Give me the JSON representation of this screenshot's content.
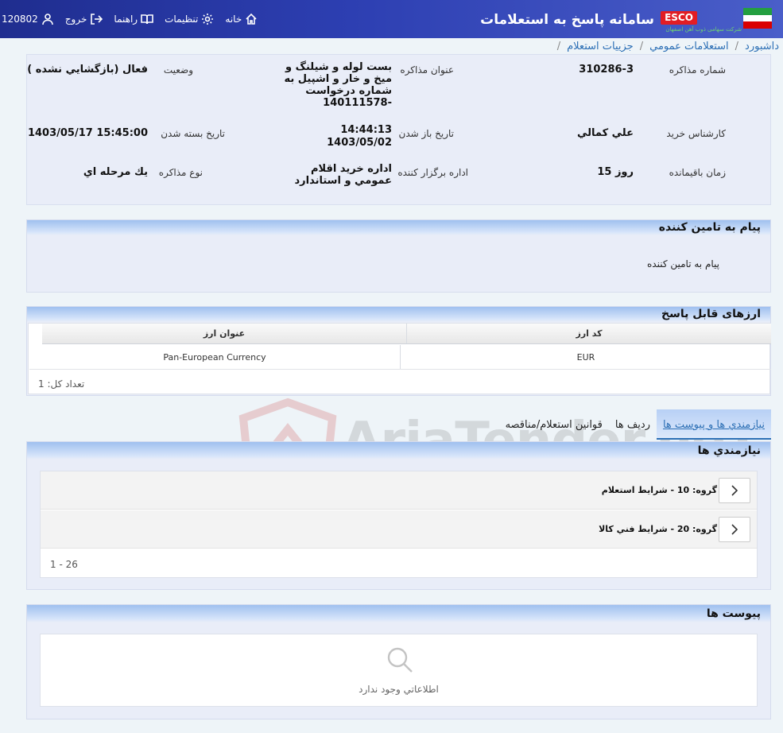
{
  "header": {
    "title": "سامانه پاسخ به استعلامات",
    "logo_text": "ESCO",
    "logo_subtitle": "شرکت سهامی ذوب آهن اصفهان",
    "nav": {
      "home": "خانه",
      "settings": "تنظیمات",
      "help": "راهنما",
      "logout": "خروج",
      "user_id": "120802"
    }
  },
  "breadcrumb": {
    "items": [
      "ه داشبورد",
      "استعلامات عمومي",
      "جزييات استعلام"
    ],
    "separator": "/"
  },
  "inquiry": {
    "number_label": "شماره مذاکره",
    "number_value": "310286-3",
    "subject_label": "عنوان مذاکره",
    "subject_value": "بست لوله و شيلنگ و ميخ و خار و اشپيل به شماره درخواست 140111578-",
    "status_label": "وضعيت",
    "status_value": "فعال (بازگشايي نشده )",
    "buyer_label": "کارشناس خريد",
    "buyer_value": "علي کمالي",
    "open_date_label": "تاريخ باز شدن",
    "open_time_value": "14:44:13",
    "open_date_value": "1403/05/02",
    "close_date_label": "تاريخ بسته شدن",
    "close_date_value": "1403/05/17 15:45:00",
    "remaining_label": "زمان باقيمانده",
    "remaining_value": "15 روز",
    "organizer_label": "اداره برگزار کننده",
    "organizer_value": "اداره خريد اقلام عمومي و استاندارد",
    "type_label": "نوع مذاکره",
    "type_value": "يك مرحله اي"
  },
  "supplier_message": {
    "title": "پيام به تامين کننده",
    "text": "پيام به تامين کننده"
  },
  "currencies": {
    "title": "ارزهای قابل پاسخ",
    "columns": [
      "کد ارز",
      "عنوان ارز"
    ],
    "rows": [
      {
        "code": "EUR",
        "name": "Pan-European Currency"
      }
    ],
    "total_label": "تعداد کل: 1"
  },
  "tabs": [
    "نيازمندي ها و پيوست ها",
    "رديف ها",
    "قوانين استعلام/مناقصه"
  ],
  "needs": {
    "title": "نيازمندي ها",
    "groups": [
      "گروه: 10 - شرايط استعلام",
      "گروه: 20 - شرايط فني كالا"
    ],
    "pager": "1 - 26"
  },
  "attachments": {
    "title": "پيوست ها",
    "empty_text": "اطلاعاتي وجود ندارد"
  },
  "watermark": "AriaTender.neT"
}
